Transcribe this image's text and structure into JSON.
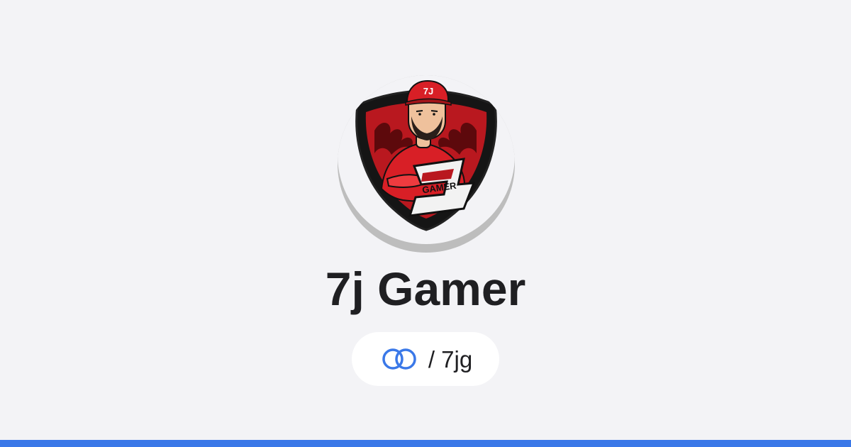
{
  "profile": {
    "name": "7j Gamer",
    "handle": "/ 7jg"
  },
  "avatar": {
    "description_icon": "gamer-mascot-logo-icon",
    "logo_text": "GAMER",
    "logo_initials": "7J"
  },
  "icons": {
    "handle": "linked-rings-icon"
  },
  "colors": {
    "background": "#f3f3f6",
    "accent": "#3a78e8",
    "text": "#1f1f22",
    "logo_red": "#d81f26"
  }
}
